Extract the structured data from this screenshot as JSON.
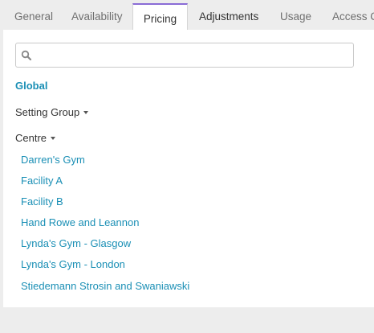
{
  "tabs": [
    {
      "label": "General"
    },
    {
      "label": "Availability"
    },
    {
      "label": "Pricing"
    },
    {
      "label": "Adjustments"
    },
    {
      "label": "Usage"
    },
    {
      "label": "Access C"
    }
  ],
  "active_tab": "Pricing",
  "search": {
    "value": "",
    "placeholder": ""
  },
  "global_label": "Global",
  "setting_group_label": "Setting Group",
  "centre_label": "Centre",
  "centres": [
    "Darren's Gym",
    "Facility A",
    "Facility B",
    "Hand Rowe and Leannon",
    "Lynda's Gym - Glasgow",
    "Lynda's Gym - London",
    "Stiedemann Strosin and Swaniawski"
  ],
  "colors": {
    "link": "#1a8fb5",
    "active_tab_accent": "#8a6cd6",
    "background": "#ededed"
  }
}
